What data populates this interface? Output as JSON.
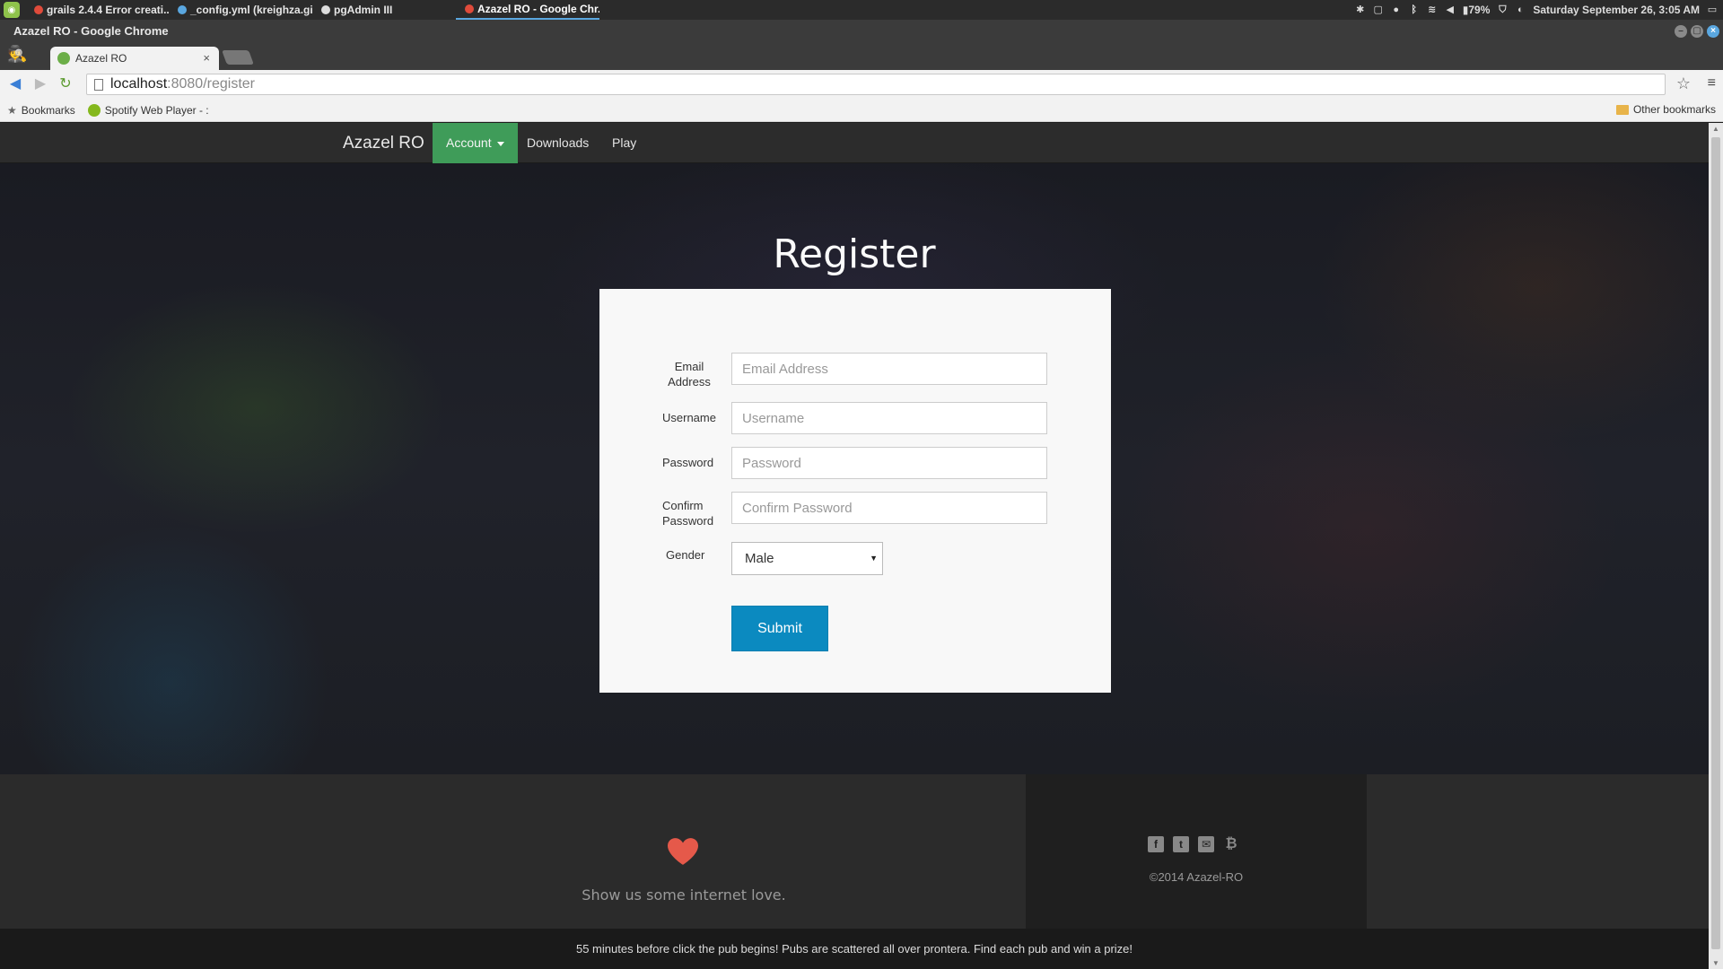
{
  "os_panel": {
    "tasks": [
      {
        "label": "grails 2.4.4 Error creati...",
        "color": "#e04b3b"
      },
      {
        "label": "_config.yml (kreighza.gi...",
        "color": "#5aa7e0"
      },
      {
        "label": "pgAdmin III",
        "color": "#dddddd"
      },
      {
        "label": "Azazel RO - Google Chr...",
        "color": "#e04b3b"
      }
    ],
    "battery": "79%",
    "datetime": "Saturday September 26,  3:05 AM"
  },
  "browser": {
    "window_title": "Azazel RO - Google Chrome",
    "tab_title": "Azazel RO",
    "tab_close": "×",
    "url_host": "localhost",
    "url_rest": ":8080/register",
    "bookmarks_label": "Bookmarks",
    "bookmark_spotify": "Spotify Web Player - :",
    "other_bookmarks": "Other bookmarks"
  },
  "site": {
    "brand": "Azazel RO",
    "nav": {
      "account": "Account",
      "downloads": "Downloads",
      "play": "Play"
    },
    "accent": "#3f9c59"
  },
  "register": {
    "title": "Register",
    "email_label": "Email Address",
    "email_placeholder": "Email Address",
    "username_label": "Username",
    "username_placeholder": "Username",
    "password_label": "Password",
    "password_placeholder": "Password",
    "confirm_label": "Confirm Password",
    "confirm_placeholder": "Confirm Password",
    "gender_label": "Gender",
    "gender_value": "Male",
    "submit_label": "Submit",
    "submit_color": "#0b8ac0"
  },
  "footer": {
    "love_text": "Show us some internet love.",
    "social_icons": [
      "facebook-icon",
      "twitter-icon",
      "email-icon",
      "bitcoin-icon"
    ],
    "copyright": "©2014 Azazel-RO",
    "ticker": "55 minutes before click the pub begins! Pubs are scattered all over prontera. Find each pub and win a prize!"
  }
}
